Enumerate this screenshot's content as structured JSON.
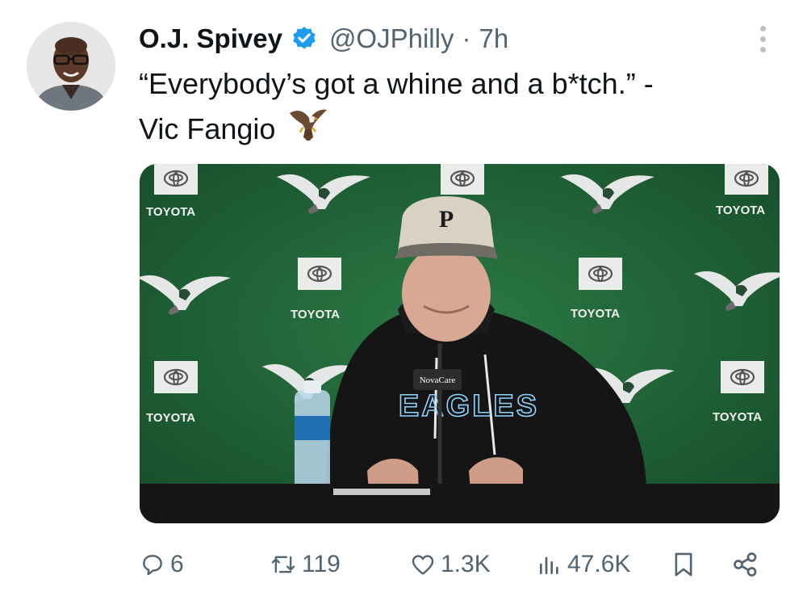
{
  "author": {
    "display_name": "O.J. Spivey",
    "handle": "@OJPhilly",
    "separator": "·",
    "time": "7h",
    "verified": true
  },
  "tweet": {
    "text_line1": "“Everybody’s got a whine and a b*tch.” -",
    "text_line2": "Vic Fangio",
    "emoji": "eagle-emoji"
  },
  "media": {
    "sponsor_label": "TOYOTA",
    "cap_letter": "P",
    "hoodie_text": "EAGLES",
    "mic_logo": "NovaCare",
    "background_color": "#1e5e34"
  },
  "actions": {
    "replies": "6",
    "reposts": "119",
    "likes": "1.3K",
    "views": "47.6K"
  },
  "colors": {
    "text": "#0f1419",
    "muted": "#536471",
    "verified_blue": "#1d9bf0"
  }
}
